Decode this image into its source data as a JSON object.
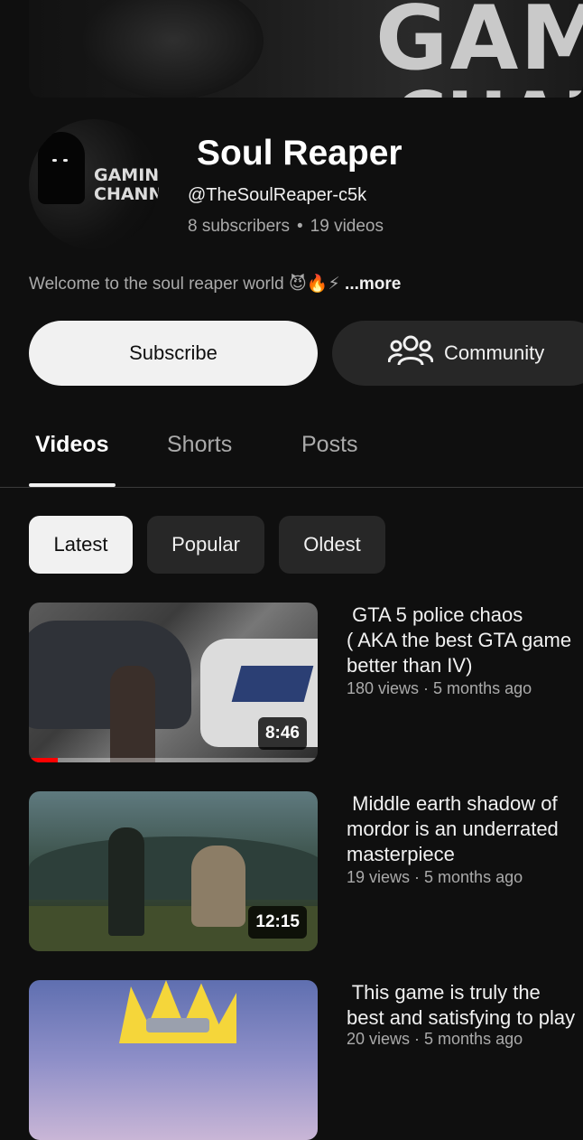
{
  "banner": {
    "text_line1": "GAMI",
    "text_line2": "CHAN"
  },
  "avatar": {
    "text": "GAMING\nCHANNE"
  },
  "channel": {
    "name": "Soul Reaper",
    "handle": "@TheSoulReaper-c5k",
    "subscribers": "8 subscribers",
    "videos_count": "19 videos",
    "separator": "•",
    "description": "Welcome to the soul reaper world 😈🔥⚡",
    "more_label": "...more"
  },
  "actions": {
    "subscribe_label": "Subscribe",
    "community_label": "Community"
  },
  "tabs": [
    {
      "label": "Videos",
      "active": true
    },
    {
      "label": "Shorts",
      "active": false
    },
    {
      "label": "Posts",
      "active": false
    }
  ],
  "filters": [
    {
      "label": "Latest",
      "active": true
    },
    {
      "label": "Popular",
      "active": false
    },
    {
      "label": "Oldest",
      "active": false
    }
  ],
  "videos": [
    {
      "title": " GTA 5 police chaos\n( AKA the best GTA game\nbetter than IV)",
      "meta": "180 views · 5 months ago",
      "duration": "8:46",
      "watched_fraction": 0.1
    },
    {
      "title": " Middle earth shadow of\nmordor is an underrated\nmasterpiece",
      "meta": "19 views · 5 months ago",
      "duration": "12:15"
    },
    {
      "title": " This game is truly the\nbest and satisfying to play",
      "meta": "20 views · 5 months ago"
    }
  ],
  "colors": {
    "background": "#0f0f0f",
    "progress": "#ff0000",
    "secondary_text": "#aaaaaa"
  }
}
